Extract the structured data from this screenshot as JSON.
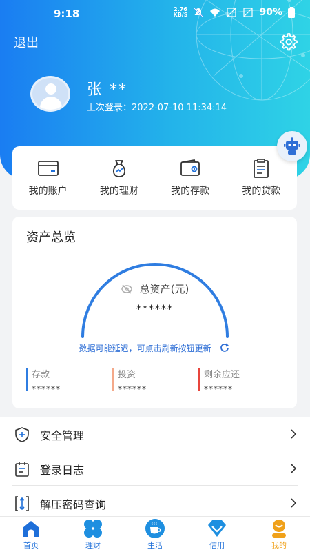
{
  "status_bar": {
    "time": "9:18",
    "net_speed_value": "2.76",
    "net_speed_unit": "KB/S",
    "battery": "90%"
  },
  "header": {
    "logout_label": "退出",
    "username": "张 **",
    "last_login": "上次登录：2022-07-10 11:34:14"
  },
  "quick_menu": [
    {
      "label": "我的账户",
      "icon": "card-icon"
    },
    {
      "label": "我的理财",
      "icon": "money-bag-icon"
    },
    {
      "label": "我的存款",
      "icon": "wallet-icon"
    },
    {
      "label": "我的贷款",
      "icon": "document-icon"
    }
  ],
  "assets": {
    "title": "资产总览",
    "total_label": "总资产(元)",
    "total_value": "******",
    "refresh_tip": "数据可能延迟，可点击刷新按钮更新",
    "breakdown": [
      {
        "label": "存款",
        "value": "******",
        "color": "#2f7de1"
      },
      {
        "label": "投资",
        "value": "******",
        "color": "#f4a98a"
      },
      {
        "label": "剩余应还",
        "value": "******",
        "color": "#e8453c"
      }
    ]
  },
  "list": [
    {
      "label": "安全管理",
      "icon": "shield-plus-icon"
    },
    {
      "label": "登录日志",
      "icon": "log-icon"
    },
    {
      "label": "解压密码查询",
      "icon": "unzip-icon"
    }
  ],
  "tabbar": [
    {
      "label": "首页",
      "icon": "home-icon",
      "active": false
    },
    {
      "label": "理财",
      "icon": "clover-icon",
      "active": false
    },
    {
      "label": "生活",
      "icon": "coffee-icon",
      "active": false
    },
    {
      "label": "信用",
      "icon": "diamond-icon",
      "active": false
    },
    {
      "label": "我的",
      "icon": "profile-icon",
      "active": true
    }
  ],
  "colors": {
    "primary": "#1e6fd9",
    "header_start": "#1a7df2",
    "header_end": "#2fd3e6",
    "active_tab": "#f0a11a"
  }
}
